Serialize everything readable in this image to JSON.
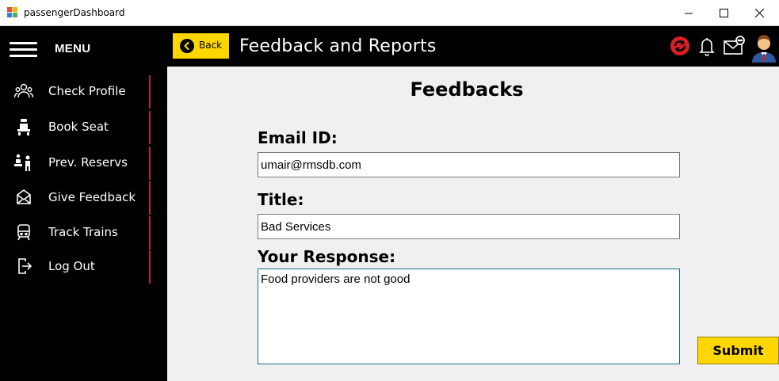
{
  "window": {
    "title": "passengerDashboard",
    "controls": [
      "minimize-icon",
      "maximize-icon",
      "close-icon"
    ]
  },
  "sidebar": {
    "menu_label": "MENU",
    "items": [
      {
        "label": "Check Profile",
        "icon": "profile-group-icon"
      },
      {
        "label": "Book Seat",
        "icon": "seat-icon"
      },
      {
        "label": "Prev. Reservs",
        "icon": "reservations-icon"
      },
      {
        "label": "Give Feedback",
        "icon": "feedback-envelope-icon"
      },
      {
        "label": "Track Trains",
        "icon": "train-icon"
      },
      {
        "label": "Log Out",
        "icon": "logout-icon"
      }
    ],
    "accent_color": "#c0272d"
  },
  "header": {
    "back_label": "Back",
    "title": "Feedback and Reports",
    "icons": [
      "refresh-icon",
      "bell-icon",
      "message-icon",
      "user-avatar-icon"
    ],
    "accent_color": "#ffd700"
  },
  "form": {
    "heading": "Feedbacks",
    "email_label": "Email ID:",
    "email_value": "umair@rmsdb.com",
    "title_label": "Title:",
    "title_value": "Bad Services",
    "response_label": "Your Response:",
    "response_value": "Food providers are not good",
    "submit_label": "Submit"
  }
}
